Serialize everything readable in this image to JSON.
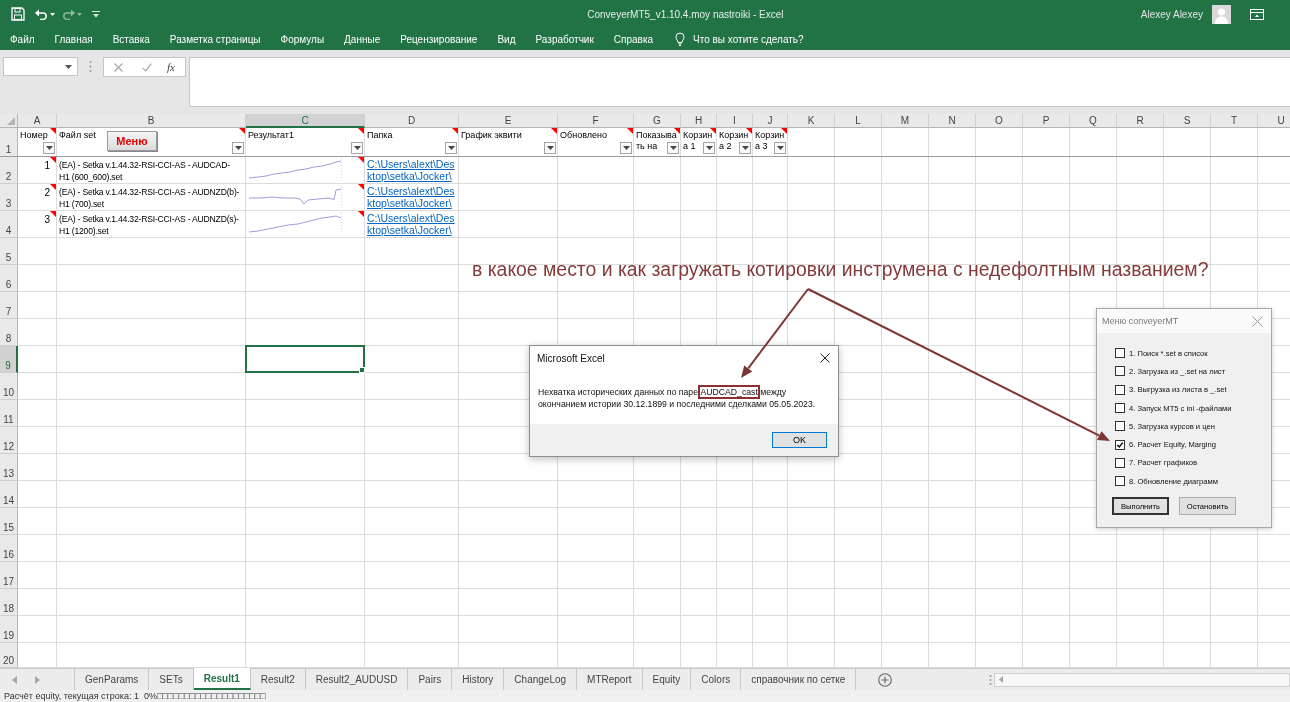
{
  "title_bar": {
    "title": "ConveyerMT5_v1.10.4.moy nastroiki - Excel",
    "user": "Alexey Alexey"
  },
  "ribbon_tabs": [
    "Файл",
    "Главная",
    "Вставка",
    "Разметка страницы",
    "Формулы",
    "Данные",
    "Рецензирование",
    "Вид",
    "Разработчик",
    "Справка"
  ],
  "tell_me": "Что вы хотите сделать?",
  "formula_bar": {
    "function_button": "fx"
  },
  "sheet": {
    "columns": [
      {
        "label": "A",
        "selected": false
      },
      {
        "label": "B",
        "selected": false
      },
      {
        "label": "C",
        "selected": true
      },
      {
        "label": "D",
        "selected": false
      },
      {
        "label": "E",
        "selected": false
      },
      {
        "label": "F",
        "selected": false
      },
      {
        "label": "G",
        "selected": false
      },
      {
        "label": "H",
        "selected": false
      },
      {
        "label": "I",
        "selected": false
      },
      {
        "label": "J",
        "selected": false
      },
      {
        "label": "K",
        "selected": false
      },
      {
        "label": "L",
        "selected": false
      },
      {
        "label": "M",
        "selected": false
      },
      {
        "label": "N",
        "selected": false
      },
      {
        "label": "O",
        "selected": false
      },
      {
        "label": "P",
        "selected": false
      },
      {
        "label": "Q",
        "selected": false
      },
      {
        "label": "R",
        "selected": false
      },
      {
        "label": "S",
        "selected": false
      },
      {
        "label": "T",
        "selected": false
      },
      {
        "label": "U",
        "selected": false
      }
    ],
    "rows": [
      {
        "label": "1",
        "selected": false
      },
      {
        "label": "2",
        "selected": false
      },
      {
        "label": "3",
        "selected": false
      },
      {
        "label": "4",
        "selected": false
      },
      {
        "label": "5",
        "selected": false
      },
      {
        "label": "6",
        "selected": false
      },
      {
        "label": "7",
        "selected": false
      },
      {
        "label": "8",
        "selected": false
      },
      {
        "label": "9",
        "selected": true
      },
      {
        "label": "10",
        "selected": false
      },
      {
        "label": "11",
        "selected": false
      },
      {
        "label": "12",
        "selected": false
      },
      {
        "label": "13",
        "selected": false
      },
      {
        "label": "14",
        "selected": false
      },
      {
        "label": "15",
        "selected": false
      },
      {
        "label": "16",
        "selected": false
      },
      {
        "label": "17",
        "selected": false
      },
      {
        "label": "18",
        "selected": false
      },
      {
        "label": "19",
        "selected": false
      },
      {
        "label": "20",
        "selected": false
      }
    ],
    "header_cells": [
      {
        "lines": [
          "Номер"
        ],
        "comment": true,
        "filter": true
      },
      {
        "lines": [
          "Файл set"
        ],
        "comment": true,
        "filter": true,
        "button": "Меню"
      },
      {
        "lines": [
          "Результат1"
        ],
        "comment": true,
        "filter": true
      },
      {
        "lines": [
          "Папка"
        ],
        "comment": true,
        "filter": true
      },
      {
        "lines": [
          "График эквити"
        ],
        "comment": true,
        "filter": true
      },
      {
        "lines": [
          "Обновлено"
        ],
        "comment": true,
        "filter": true
      },
      {
        "lines": [
          "Показыва",
          "ть на"
        ],
        "comment": true,
        "filter": true
      },
      {
        "lines": [
          "Корзин",
          "а 1"
        ],
        "comment": true,
        "filter": true
      },
      {
        "lines": [
          "Корзин",
          "а 2"
        ],
        "comment": true,
        "filter": true
      },
      {
        "lines": [
          "Корзин",
          "а 3"
        ],
        "comment": true,
        "filter": true
      }
    ],
    "records": [
      {
        "number": "1",
        "number_comment": true,
        "file_lines": [
          "(EA) - Setka v.1.44.32-RSI-CCI-AS - AUDCAD-",
          "H1 (600_600).set"
        ],
        "chart_comment": true,
        "link_lines": [
          "C:\\Users\\alext\\Des",
          "ktop\\setka\\Jocker\\"
        ]
      },
      {
        "number": "2",
        "number_comment": true,
        "file_lines": [
          "(EA) - Setka v.1.44.32-RSI-CCI-AS - AUDNZD(b)-",
          "H1 (700).set"
        ],
        "chart_comment": true,
        "link_lines": [
          "C:\\Users\\alext\\Des",
          "ktop\\setka\\Jocker\\"
        ]
      },
      {
        "number": "3",
        "number_comment": true,
        "file_lines": [
          "(EA) - Setka v.1.44.32-RSI-CCI-AS - AUDNZD(s)-",
          "H1 (1200).set"
        ],
        "chart_comment": true,
        "link_lines": [
          "C:\\Users\\alext\\Des",
          "ktop\\setka\\Jocker\\"
        ]
      }
    ]
  },
  "annotation": "в какое место и как загружать котировки инструмена с недефолтным названием?",
  "dialog": {
    "title": "Microsoft Excel",
    "message": [
      {
        "text": "Нехватка исторических данных по паре ",
        "highlighted": false
      },
      {
        "text": "AUDCAD_cast",
        "highlighted": true
      },
      {
        "text": " между окончанием истории 30.12.1899 и последними сделками 05.05.2023.",
        "highlighted": false
      }
    ],
    "button": "OK"
  },
  "macro_menu": {
    "title": "Меню conveyerMT",
    "items": [
      {
        "label": "1. Поиск *.set в список",
        "checked": false
      },
      {
        "label": "2. Загрузка из _.set на лист",
        "checked": false
      },
      {
        "label": "3. Выгрузка из листа в _.set",
        "checked": false
      },
      {
        "label": "4. Запуск MT5 с ini -файлами",
        "checked": false
      },
      {
        "label": "5. Загрузка курсов и цен",
        "checked": false
      },
      {
        "label": "6. Расчет Equity, Marging",
        "checked": true
      },
      {
        "label": "7. Расчет графиков",
        "checked": false
      },
      {
        "label": "8. Обновление диаграмм",
        "checked": false
      }
    ],
    "buttons": [
      {
        "label": "Выполнить",
        "default": true
      },
      {
        "label": "Остановить",
        "default": false
      }
    ]
  },
  "sheet_tabs": [
    {
      "label": "GenParams",
      "selected": false
    },
    {
      "label": "SETs",
      "selected": false
    },
    {
      "label": "Result1",
      "selected": true
    },
    {
      "label": "Result2",
      "selected": false
    },
    {
      "label": "Result2_AUDUSD",
      "selected": false
    },
    {
      "label": "Pairs",
      "selected": false
    },
    {
      "label": "History",
      "selected": false
    },
    {
      "label": "ChangeLog",
      "selected": false
    },
    {
      "label": "MTReport",
      "selected": false
    },
    {
      "label": "Equity",
      "selected": false
    },
    {
      "label": "Colors",
      "selected": false
    },
    {
      "label": "справочник по сетке",
      "selected": false
    }
  ],
  "status_bar": "Расчёт equity, текущая строка: 1  0%□□□□□□□□□□□□□□□□□□□□"
}
